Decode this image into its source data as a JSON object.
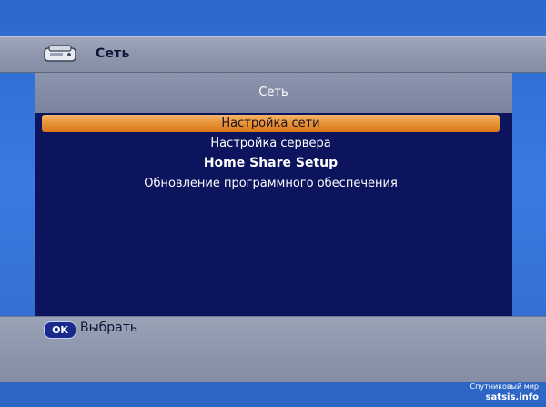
{
  "header": {
    "title": "Сеть",
    "icon": "network-device-icon"
  },
  "panel": {
    "title": "Сеть",
    "menu": [
      {
        "label": "Настройка сети",
        "selected": true
      },
      {
        "label": "Настройка сервера",
        "selected": false
      },
      {
        "label": "Home Share Setup",
        "selected": false
      },
      {
        "label": "Обновление программного обеспечения",
        "selected": false
      }
    ]
  },
  "footer": {
    "ok_key": "OK",
    "ok_label": "Выбрать"
  },
  "watermark": {
    "line1": "Спутниковый мир",
    "line2": "satsis.info"
  },
  "colors": {
    "background": "#2f6cd0",
    "panel": "#0b145c",
    "highlight": "#e48d2e"
  }
}
